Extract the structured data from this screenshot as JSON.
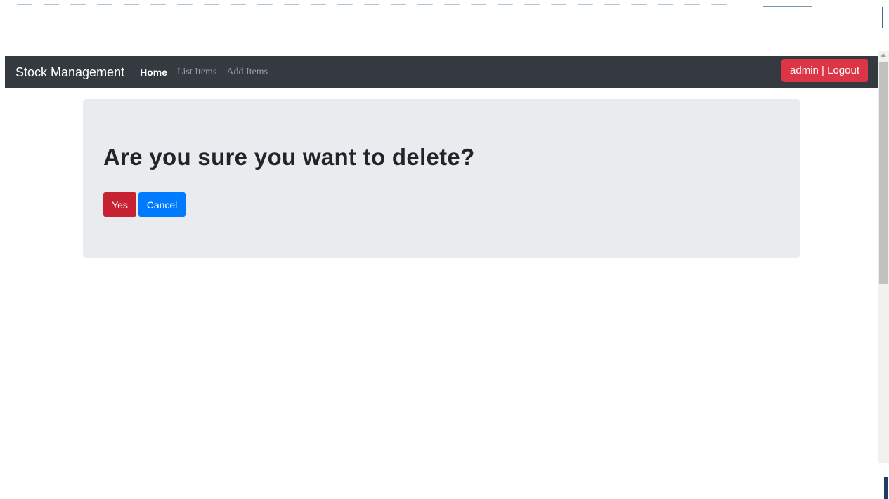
{
  "navbar": {
    "brand": "Stock Management",
    "links": [
      {
        "label": "Home",
        "active": true
      },
      {
        "label": "List Items",
        "active": false
      },
      {
        "label": "Add Items",
        "active": false
      }
    ],
    "logout_label": "admin | Logout"
  },
  "dialog": {
    "heading": "Are you sure you want to delete?",
    "yes_label": "Yes",
    "cancel_label": "Cancel"
  },
  "colors": {
    "navbar_bg": "#343a40",
    "danger": "#dc3545",
    "danger_dark": "#c82333",
    "primary": "#007bff",
    "jumbotron_bg": "#e9ecef"
  }
}
